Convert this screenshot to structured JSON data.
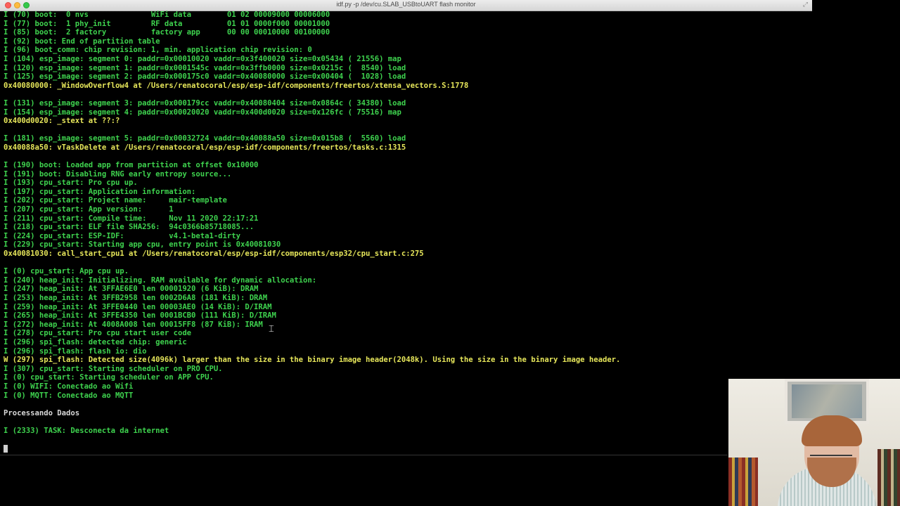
{
  "window": {
    "title": "idf.py -p /dev/cu.SLAB_USBtoUART flash monitor"
  },
  "terminal": {
    "lines": [
      {
        "text": "I (70) boot:  0 nvs              WiFi data        01 02 00009000 00006000",
        "color": "green"
      },
      {
        "text": "I (77) boot:  1 phy_init         RF data          01 01 0000f000 00001000",
        "color": "green"
      },
      {
        "text": "I (85) boot:  2 factory          factory app      00 00 00010000 00100000",
        "color": "green"
      },
      {
        "text": "I (92) boot: End of partition table",
        "color": "green"
      },
      {
        "text": "I (96) boot_comm: chip revision: 1, min. application chip revision: 0",
        "color": "green"
      },
      {
        "text": "I (104) esp_image: segment 0: paddr=0x00010020 vaddr=0x3f400020 size=0x05434 ( 21556) map",
        "color": "green"
      },
      {
        "text": "I (120) esp_image: segment 1: paddr=0x0001545c vaddr=0x3ffb0000 size=0x0215c (  8540) load",
        "color": "green"
      },
      {
        "text": "I (125) esp_image: segment 2: paddr=0x000175c0 vaddr=0x40080000 size=0x00404 (  1028) load",
        "color": "green"
      },
      {
        "text": "0x40080000: _WindowOverflow4 at /Users/renatocoral/esp/esp-idf/components/freertos/xtensa_vectors.S:1778",
        "color": "yellow"
      },
      {
        "text": "",
        "color": "green"
      },
      {
        "text": "I (131) esp_image: segment 3: paddr=0x000179cc vaddr=0x40080404 size=0x0864c ( 34380) load",
        "color": "green"
      },
      {
        "text": "I (154) esp_image: segment 4: paddr=0x00020020 vaddr=0x400d0020 size=0x126fc ( 75516) map",
        "color": "green"
      },
      {
        "text": "0x400d0020: _stext at ??:?",
        "color": "yellow"
      },
      {
        "text": "",
        "color": "green"
      },
      {
        "text": "I (181) esp_image: segment 5: paddr=0x00032724 vaddr=0x40088a50 size=0x015b8 (  5560) load",
        "color": "green"
      },
      {
        "text": "0x40088a50: vTaskDelete at /Users/renatocoral/esp/esp-idf/components/freertos/tasks.c:1315",
        "color": "yellow"
      },
      {
        "text": "",
        "color": "green"
      },
      {
        "text": "I (190) boot: Loaded app from partition at offset 0x10000",
        "color": "green"
      },
      {
        "text": "I (191) boot: Disabling RNG early entropy source...",
        "color": "green"
      },
      {
        "text": "I (193) cpu_start: Pro cpu up.",
        "color": "green"
      },
      {
        "text": "I (197) cpu_start: Application information:",
        "color": "green"
      },
      {
        "text": "I (202) cpu_start: Project name:     mair-template",
        "color": "green"
      },
      {
        "text": "I (207) cpu_start: App version:      1",
        "color": "green"
      },
      {
        "text": "I (211) cpu_start: Compile time:     Nov 11 2020 22:17:21",
        "color": "green"
      },
      {
        "text": "I (218) cpu_start: ELF file SHA256:  94c0366b85718085...",
        "color": "green"
      },
      {
        "text": "I (224) cpu_start: ESP-IDF:          v4.1-beta1-dirty",
        "color": "green"
      },
      {
        "text": "I (229) cpu_start: Starting app cpu, entry point is 0x40081030",
        "color": "green"
      },
      {
        "text": "0x40081030: call_start_cpu1 at /Users/renatocoral/esp/esp-idf/components/esp32/cpu_start.c:275",
        "color": "yellow"
      },
      {
        "text": "",
        "color": "green"
      },
      {
        "text": "I (0) cpu_start: App cpu up.",
        "color": "green"
      },
      {
        "text": "I (240) heap_init: Initializing. RAM available for dynamic allocation:",
        "color": "green"
      },
      {
        "text": "I (247) heap_init: At 3FFAE6E0 len 00001920 (6 KiB): DRAM",
        "color": "green"
      },
      {
        "text": "I (253) heap_init: At 3FFB2958 len 0002D6A8 (181 KiB): DRAM",
        "color": "green"
      },
      {
        "text": "I (259) heap_init: At 3FFE0440 len 00003AE0 (14 KiB): D/IRAM",
        "color": "green"
      },
      {
        "text": "I (265) heap_init: At 3FFE4350 len 0001BCB0 (111 KiB): D/IRAM",
        "color": "green"
      },
      {
        "text": "I (272) heap_init: At 4008A008 len 00015FF8 (87 KiB): IRAM",
        "color": "green"
      },
      {
        "text": "I (278) cpu_start: Pro cpu start user code",
        "color": "green"
      },
      {
        "text": "I (296) spi_flash: detected chip: generic",
        "color": "green"
      },
      {
        "text": "I (296) spi_flash: flash io: dio",
        "color": "green"
      },
      {
        "text": "W (297) spi_flash: Detected size(4096k) larger than the size in the binary image header(2048k). Using the size in the binary image header.",
        "color": "yellow"
      },
      {
        "text": "I (307) cpu_start: Starting scheduler on PRO CPU.",
        "color": "green"
      },
      {
        "text": "I (0) cpu_start: Starting scheduler on APP CPU.",
        "color": "green"
      },
      {
        "text": "I (0) WIFI: Conectado ao Wifi",
        "color": "green"
      },
      {
        "text": "I (0) MQTT: Conectado ao MQTT",
        "color": "green"
      },
      {
        "text": "",
        "color": "green"
      },
      {
        "text": "Processando Dados",
        "color": "white"
      },
      {
        "text": "",
        "color": "green"
      },
      {
        "text": "I (2333) TASK: Desconecta da internet",
        "color": "green"
      }
    ]
  },
  "colors": {
    "info": "#3ed24e",
    "warning": "#e6e65a",
    "plain": "#d8d8d8",
    "background": "#000000"
  },
  "icons": {
    "mouse": "text-cursor-icon",
    "close": "close-icon",
    "minimize": "minimize-icon",
    "zoom": "zoom-icon"
  }
}
